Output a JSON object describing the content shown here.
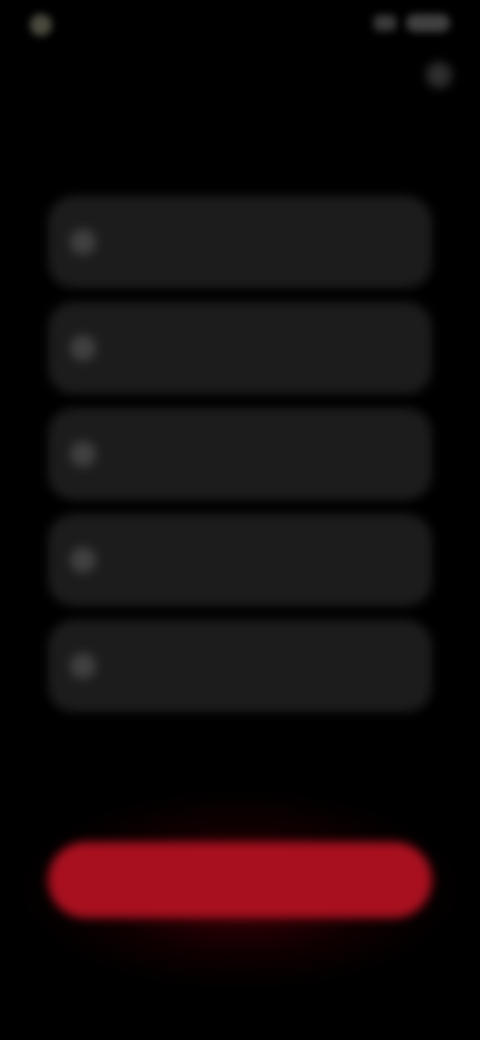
{
  "status_bar": {
    "time": "",
    "icons": [
      "signal-icon",
      "battery-icon"
    ]
  },
  "header": {
    "title": "",
    "subtitle": ""
  },
  "options": [
    {
      "icon": "option-icon",
      "title": "",
      "description": ""
    },
    {
      "icon": "option-icon",
      "title": "",
      "description": ""
    },
    {
      "icon": "option-icon",
      "title": "",
      "description": ""
    },
    {
      "icon": "option-icon",
      "title": "",
      "description": ""
    },
    {
      "icon": "option-icon",
      "title": "",
      "description": ""
    }
  ],
  "cta": {
    "label": "",
    "color": "#a8101f"
  },
  "colors": {
    "background": "#000000",
    "card": "#1c1c1c",
    "accent": "#a8101f"
  }
}
